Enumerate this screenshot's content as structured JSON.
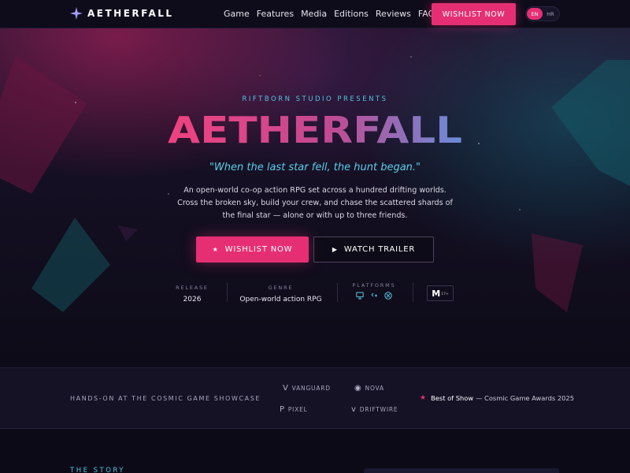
{
  "nav": {
    "logo_text": "AETHERFALL",
    "logo_icon": "four-point-star-icon",
    "links": [
      "Game",
      "Features",
      "Media",
      "Editions",
      "Reviews",
      "FAQ"
    ],
    "cta_label": "WISHLIST NOW",
    "languages": [
      "EN",
      "HR"
    ],
    "active_language": "EN"
  },
  "hero": {
    "eyebrow": "RIFTBORN STUDIO PRESENTS",
    "title": "AETHERFALL",
    "tagline": "\"When the last star fell, the hunt began.\"",
    "description": "An open-world co-op action RPG set across a hundred drifting worlds. Cross the broken sky, build your crew, and chase the scattered shards of the final star — alone or with up to three friends.",
    "primary_button": "WISHLIST NOW",
    "primary_icon": "star-icon",
    "secondary_button": "WATCH TRAILER",
    "secondary_icon": "play-icon",
    "meta": {
      "release_label": "RELEASE",
      "release_value": "2026",
      "genre_label": "GENRE",
      "genre_value": "Open-world action RPG",
      "platforms_label": "PLATFORMS",
      "platform_icons": [
        "monitor-icon",
        "gamepad-icon",
        "xbox-icon"
      ],
      "rating_letter": "M",
      "rating_sub": "17+"
    }
  },
  "press": {
    "label": "HANDS-ON AT THE COSMIC GAME SHOWCASE",
    "publications": [
      {
        "mark": "V",
        "name": "VANGUARD"
      },
      {
        "mark": "◉",
        "name": "NOVA"
      },
      {
        "mark": "P",
        "name": "PIXEL"
      },
      {
        "mark": "v",
        "name": "DRIFTWIRE"
      }
    ],
    "award_highlight": "Best of Show",
    "award_rest": "— Cosmic Game Awards 2025"
  },
  "story": {
    "kicker": "THE STORY"
  },
  "colors": {
    "accent": "#e62f73",
    "cyan": "#4fc6e0",
    "background": "#0c0a17"
  }
}
